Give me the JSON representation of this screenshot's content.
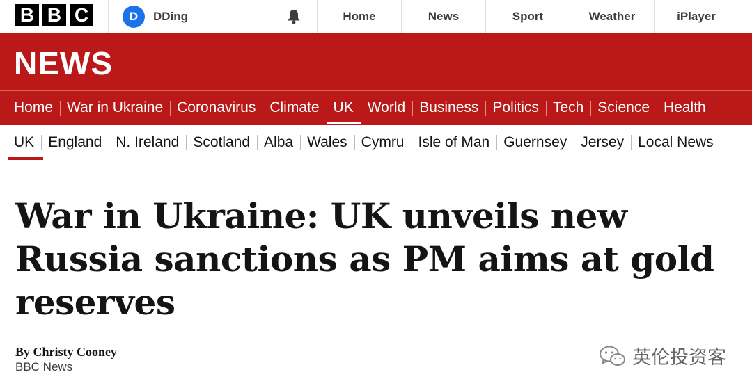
{
  "masthead": {
    "logo_letters": [
      "B",
      "B",
      "C"
    ],
    "account": {
      "initial": "D",
      "name": "DDing"
    },
    "notifications_icon": "bell-icon",
    "links": [
      "Home",
      "News",
      "Sport",
      "Weather",
      "iPlayer"
    ]
  },
  "news_banner": {
    "logo": "NEWS",
    "primary_nav": [
      "Home",
      "War in Ukraine",
      "Coronavirus",
      "Climate",
      "UK",
      "World",
      "Business",
      "Politics",
      "Tech",
      "Science",
      "Health"
    ],
    "active_primary": "UK"
  },
  "secondary_nav": {
    "items": [
      "UK",
      "England",
      "N. Ireland",
      "Scotland",
      "Alba",
      "Wales",
      "Cymru",
      "Isle of Man",
      "Guernsey",
      "Jersey",
      "Local News"
    ],
    "active": "UK"
  },
  "article": {
    "headline": "War in Ukraine: UK unveils new Russia sanctions as PM aims at gold reserves",
    "author": "By Christy Cooney",
    "organisation": "BBC News"
  },
  "watermark": {
    "text": "英伦投资客",
    "icon": "wechat-icon"
  },
  "colors": {
    "brand_red": "#bb1919",
    "avatar_blue": "#1a73e8"
  }
}
